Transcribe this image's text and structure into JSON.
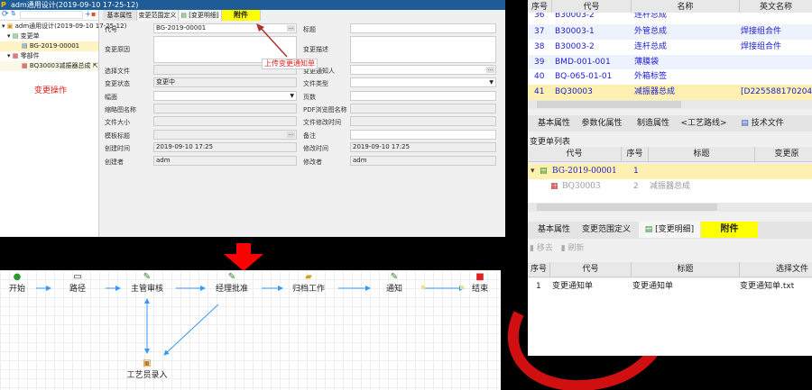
{
  "window": {
    "title": "adm通用设计(2019-09-10  17-25-12)",
    "logo": "P"
  },
  "tree": {
    "root": "adm通用设计(2019-09-10  17-25-12)",
    "change_orders": "变更单",
    "order": "BG-2019-00001",
    "parts": "零部件",
    "part": "BQ30003减振器总成",
    "annotation": "变更操作"
  },
  "tabs": [
    "基本属性",
    "变更范围定义",
    "[变更明细]",
    "附件"
  ],
  "form": {
    "left": [
      {
        "label": "代号",
        "value": "BG-2019-00001"
      },
      {
        "label": "变更原因",
        "value": ""
      },
      {
        "label": "选择文件",
        "value": ""
      },
      {
        "label": "变更状态",
        "value": "变更中"
      },
      {
        "label": "幅面",
        "value": ""
      },
      {
        "label": "缩略图名称",
        "value": ""
      },
      {
        "label": "文件大小",
        "value": ""
      },
      {
        "label": "模板标题",
        "value": ""
      },
      {
        "label": "创建时间",
        "value": "2019-09-10 17:25"
      },
      {
        "label": "创建者",
        "value": "adm"
      }
    ],
    "right": [
      {
        "label": "标题",
        "value": ""
      },
      {
        "label": "变更描述",
        "value": ""
      },
      {
        "label": "变更通知人",
        "value": ""
      },
      {
        "label": "文件类型",
        "value": ""
      },
      {
        "label": "页数",
        "value": ""
      },
      {
        "label": "PDF浏览图名称",
        "value": ""
      },
      {
        "label": "文件修改时间",
        "value": ""
      },
      {
        "label": "备注",
        "value": ""
      },
      {
        "label": "修改时间",
        "value": "2019-09-10 17:25"
      },
      {
        "label": "修改者",
        "value": "adm"
      }
    ]
  },
  "callout": "上传变更通知单",
  "flow": {
    "nodes": [
      "开始",
      "路径",
      "主管审核",
      "经理批准",
      "归档工作",
      "通知",
      "结束",
      "工艺员录入"
    ]
  },
  "parts_table": {
    "headers": [
      "序号",
      "代号",
      "名称",
      "英文名称"
    ],
    "rows": [
      [
        "36",
        "B30003-2",
        "连杆总成",
        ""
      ],
      [
        "37",
        "B30003-1",
        "外管总成",
        "焊接组合件"
      ],
      [
        "38",
        "B30003-2",
        "连杆总成",
        "焊接组合件"
      ],
      [
        "39",
        "BMD-001-001",
        "薄膜袋",
        ""
      ],
      [
        "40",
        "BQ-065-01-01",
        "外箱标签",
        ""
      ],
      [
        "41",
        "BQ30003",
        "减振器总成",
        "[D225588170204]"
      ]
    ]
  },
  "prop_tabs": [
    "基本属性",
    "参数化属性",
    "制造属性",
    "<工艺路线>",
    "技术文件"
  ],
  "change_list": {
    "title": "变更单列表",
    "headers": [
      "代号",
      "序号",
      "标题",
      "变更原"
    ],
    "rows": [
      [
        "BG-2019-00001",
        "1",
        ""
      ],
      [
        "BQ30003",
        "2",
        "减振器总成"
      ]
    ]
  },
  "detail_tabs": [
    "基本属性",
    "变更范围定义",
    "[变更明细]",
    "附件"
  ],
  "toolbar": {
    "remove": "移去",
    "refresh": "刷新"
  },
  "attach_table": {
    "headers": [
      "序号",
      "代号",
      "标题",
      "选择文件"
    ],
    "rows": [
      [
        "1",
        "变更通知单",
        "变更通知单",
        "变更通知单.txt"
      ]
    ]
  },
  "colors": {
    "highlight": "#ffff00",
    "arrow": "#e00000",
    "link": "#2020d0"
  }
}
